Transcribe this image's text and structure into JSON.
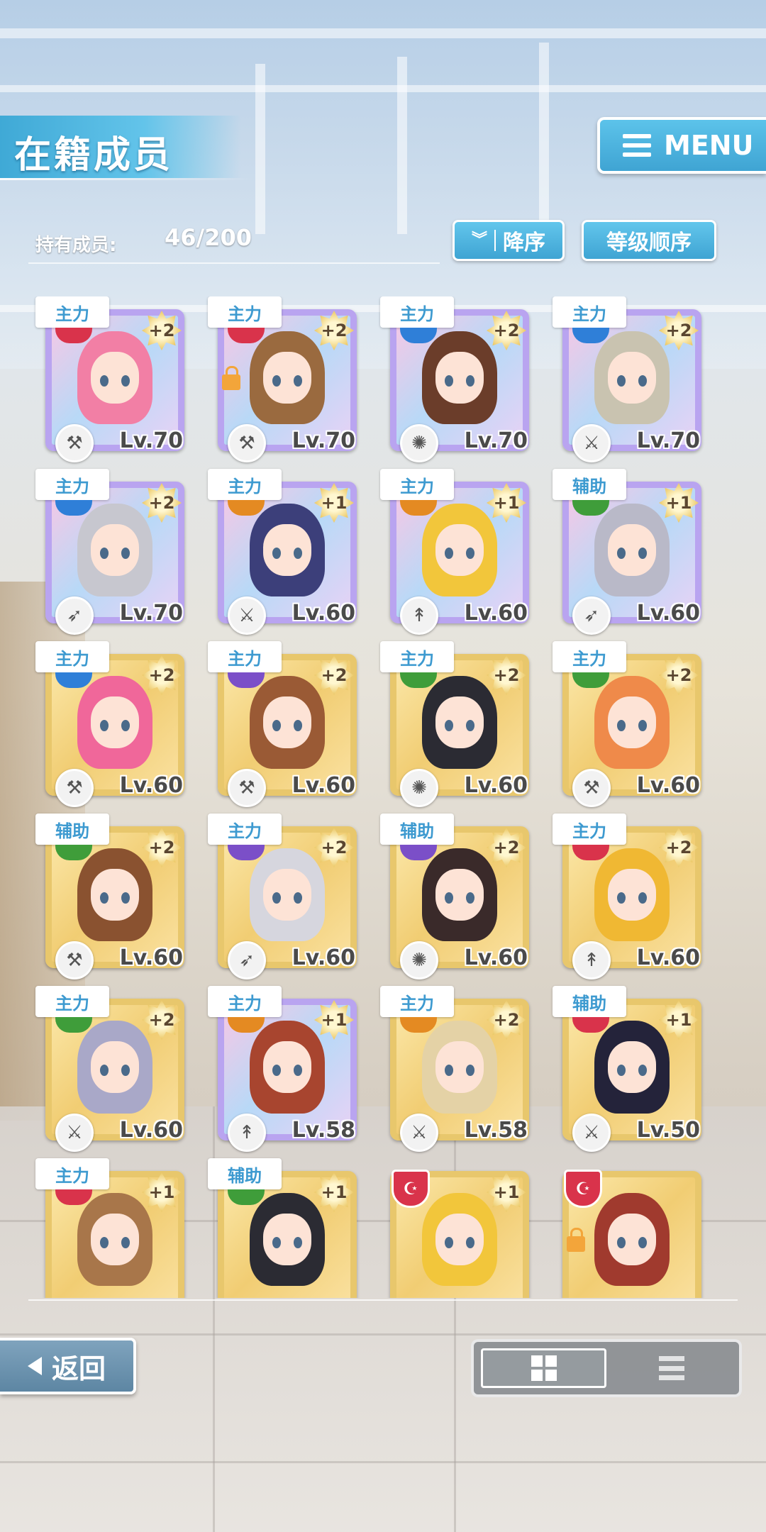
{
  "header": {
    "title": "在籍成员",
    "menu_label": "MENU"
  },
  "summary": {
    "label": "持有成员:",
    "count": "46/200"
  },
  "sort": {
    "order_label": "降序",
    "key_label": "等级顺序"
  },
  "members": [
    {
      "role": "主力",
      "shield": "red",
      "plus": "+2",
      "level": "Lv.70",
      "frame": "rainbow",
      "hair": "#f27fa5",
      "weapon": "hammer-icon",
      "locked": false
    },
    {
      "role": "主力",
      "shield": "red",
      "plus": "+2",
      "level": "Lv.70",
      "frame": "rainbow",
      "hair": "#9a6a3f",
      "weapon": "hammer-icon",
      "locked": true
    },
    {
      "role": "主力",
      "shield": "blue",
      "plus": "+2",
      "level": "Lv.70",
      "frame": "rainbow",
      "hair": "#6b3d2a",
      "weapon": "gear-icon",
      "locked": false
    },
    {
      "role": "主力",
      "shield": "blue",
      "plus": "+2",
      "level": "Lv.70",
      "frame": "rainbow",
      "hair": "#c9c3b0",
      "weapon": "sword-icon",
      "locked": false
    },
    {
      "role": "主力",
      "shield": "blue",
      "plus": "+2",
      "level": "Lv.70",
      "frame": "rainbow",
      "hair": "#c7c7cf",
      "weapon": "bow-icon",
      "locked": false
    },
    {
      "role": "主力",
      "shield": "orange",
      "plus": "+1",
      "level": "Lv.60",
      "frame": "rainbow",
      "hair": "#3c3f7a",
      "weapon": "sword-icon",
      "locked": false
    },
    {
      "role": "主力",
      "shield": "orange",
      "plus": "+1",
      "level": "Lv.60",
      "frame": "rainbow",
      "hair": "#f2c63b",
      "weapon": "lance-icon",
      "locked": false
    },
    {
      "role": "辅助",
      "shield": "green",
      "plus": "+1",
      "level": "Lv.60",
      "frame": "rainbow",
      "hair": "#b9b9c8",
      "weapon": "bow-icon",
      "locked": false
    },
    {
      "role": "主力",
      "shield": "blue",
      "plus": "+2",
      "level": "Lv.60",
      "frame": "gold",
      "hair": "#f0679a",
      "weapon": "hammer-icon",
      "locked": false
    },
    {
      "role": "主力",
      "shield": "purple",
      "plus": "+2",
      "level": "Lv.60",
      "frame": "gold",
      "hair": "#9a5a35",
      "weapon": "hammer-icon",
      "locked": false
    },
    {
      "role": "主力",
      "shield": "green",
      "plus": "+2",
      "level": "Lv.60",
      "frame": "gold",
      "hair": "#2b2b33",
      "weapon": "gear-icon",
      "locked": false
    },
    {
      "role": "主力",
      "shield": "green",
      "plus": "+2",
      "level": "Lv.60",
      "frame": "gold",
      "hair": "#ef8a4a",
      "weapon": "hammer-icon",
      "locked": false
    },
    {
      "role": "辅助",
      "shield": "green",
      "plus": "+2",
      "level": "Lv.60",
      "frame": "gold",
      "hair": "#8a5230",
      "weapon": "hammer-icon",
      "locked": false
    },
    {
      "role": "主力",
      "shield": "purple",
      "plus": "+2",
      "level": "Lv.60",
      "frame": "gold",
      "hair": "#d6d6de",
      "weapon": "bow-icon",
      "locked": false
    },
    {
      "role": "辅助",
      "shield": "purple",
      "plus": "+2",
      "level": "Lv.60",
      "frame": "gold",
      "hair": "#3a2a2a",
      "weapon": "gear-icon",
      "locked": false
    },
    {
      "role": "主力",
      "shield": "red",
      "plus": "+2",
      "level": "Lv.60",
      "frame": "gold",
      "hair": "#f0b833",
      "weapon": "lance-icon",
      "locked": false
    },
    {
      "role": "主力",
      "shield": "green",
      "plus": "+2",
      "level": "Lv.60",
      "frame": "gold",
      "hair": "#a9a8c8",
      "weapon": "sword-icon",
      "locked": false
    },
    {
      "role": "主力",
      "shield": "orange",
      "plus": "+1",
      "level": "Lv.58",
      "frame": "rainbow",
      "hair": "#a8452f",
      "weapon": "lance-icon",
      "locked": false
    },
    {
      "role": "主力",
      "shield": "orange",
      "plus": "+2",
      "level": "Lv.58",
      "frame": "gold",
      "hair": "#e4d2a6",
      "weapon": "sword-icon",
      "locked": false
    },
    {
      "role": "辅助",
      "shield": "red",
      "plus": "+1",
      "level": "Lv.50",
      "frame": "gold",
      "hair": "#24233a",
      "weapon": "sword-icon",
      "locked": false
    },
    {
      "role": "主力",
      "shield": "red",
      "plus": "+1",
      "level": "",
      "frame": "gold",
      "hair": "#a8764a",
      "weapon": "",
      "locked": false
    },
    {
      "role": "辅助",
      "shield": "green",
      "plus": "+1",
      "level": "",
      "frame": "gold",
      "hair": "#2b2b33",
      "weapon": "",
      "locked": false
    },
    {
      "role": "",
      "shield": "red",
      "plus": "+1",
      "level": "",
      "frame": "gold",
      "hair": "#f2c63b",
      "weapon": "",
      "locked": false
    },
    {
      "role": "",
      "shield": "red",
      "plus": "",
      "level": "",
      "frame": "gold",
      "hair": "#a03a2e",
      "weapon": "",
      "locked": true
    }
  ],
  "footer": {
    "back_label": "返回",
    "view_active": "grid"
  }
}
